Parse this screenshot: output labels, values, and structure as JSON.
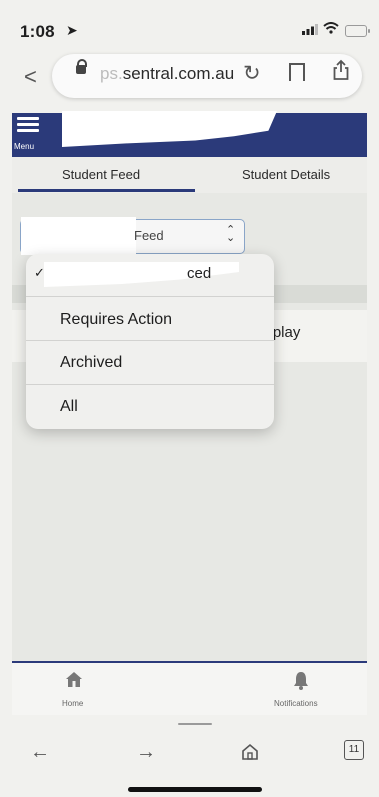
{
  "status_bar": {
    "time": "1:08",
    "location_icon": "location-arrow-icon",
    "signal_icon": "cellular-signal-icon",
    "wifi_icon": "wifi-icon",
    "battery_icon": "battery-icon"
  },
  "browser": {
    "url_faint": "ps.",
    "url": "sentral.com.au",
    "tab_count": "11"
  },
  "app": {
    "menu_label": "Menu",
    "tabs": [
      {
        "label": "Student Feed",
        "active": true
      },
      {
        "label": "Student Details",
        "active": false
      }
    ],
    "feed_select": {
      "value": "Feed"
    },
    "dropdown": {
      "selected_partial": "ced",
      "options": [
        "Requires Action",
        "Archived",
        "All"
      ]
    },
    "partial_text": "isplay",
    "bottom_nav": [
      {
        "label": "Home",
        "icon": "home-icon"
      },
      {
        "label": "Notifications",
        "icon": "bell-icon"
      }
    ]
  },
  "colors": {
    "brand": "#2b3a7a",
    "select_border": "#8aa5c8"
  }
}
